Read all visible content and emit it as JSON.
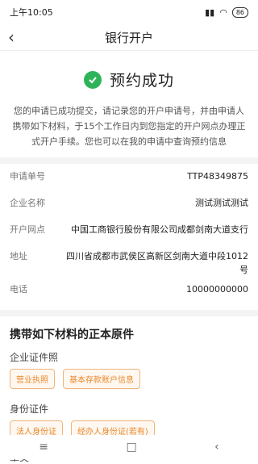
{
  "status": {
    "time": "上午10:05",
    "battery": "86"
  },
  "header": {
    "title": "银行开户"
  },
  "success_text": "预约成功",
  "description": "您的申请已成功提交，请记录您的开户申请号，并由申请人携带如下材料，于15个工作日内到您指定的开户网点办理正式开户手续。您也可以在我的申请中查询预约信息",
  "info": [
    {
      "label": "申请单号",
      "value": "TTP48349875"
    },
    {
      "label": "企业名称",
      "value": "测试测试测试"
    },
    {
      "label": "开户网点",
      "value": "中国工商银行股份有限公司成都剑南大道支行"
    },
    {
      "label": "地址",
      "value": "四川省成都市武侯区高新区剑南大道中段1012号"
    },
    {
      "label": "电话",
      "value": "10000000000"
    }
  ],
  "materials": {
    "title": "携带如下材料的正本原件",
    "groups": [
      {
        "name": "企业证件照",
        "tags": [
          "营业执照",
          "基本存款账户信息"
        ]
      },
      {
        "name": "身份证件",
        "tags": [
          "法人身份证",
          "经办人身份证(若有)"
        ]
      }
    ],
    "more": "章类"
  }
}
